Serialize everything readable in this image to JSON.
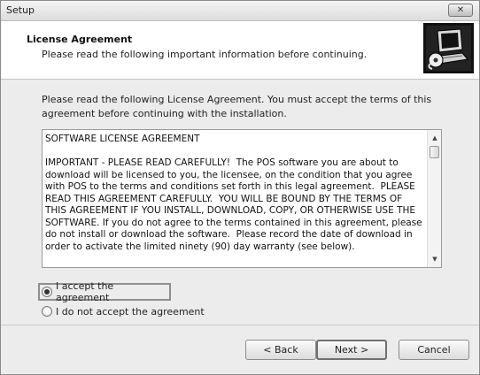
{
  "window": {
    "title": "Setup",
    "close_glyph": "✕"
  },
  "header": {
    "title": "License Agreement",
    "subtitle": "Please read the following important information before continuing.",
    "icon": "setup-computer-icon"
  },
  "intro": "Please read the following License Agreement. You must accept the terms of this agreement before continuing with the installation.",
  "license": {
    "heading": "SOFTWARE LICENSE AGREEMENT",
    "body": "IMPORTANT - PLEASE READ CAREFULLY!  The POS software you are about to download will be licensed to you, the licensee, on the condition that you agree with POS to the terms and conditions set forth in this legal agreement.  PLEASE READ THIS AGREEMENT CAREFULLY.  YOU WILL BE BOUND BY THE TERMS OF THIS AGREEMENT IF YOU INSTALL, DOWNLOAD, COPY, OR OTHERWISE USE THE SOFTWARE. If you do not agree to the terms contained in this agreement, please do not install or download the software.  Please record the date of download in order to activate the limited ninety (90) day warranty (see below).",
    "scroll_up": "▲",
    "scroll_down": "▼"
  },
  "options": {
    "accept": "I accept the agreement",
    "decline": "I do not accept the agreement",
    "selected": "accept"
  },
  "buttons": {
    "back": "< Back",
    "next": "Next >",
    "cancel": "Cancel"
  }
}
